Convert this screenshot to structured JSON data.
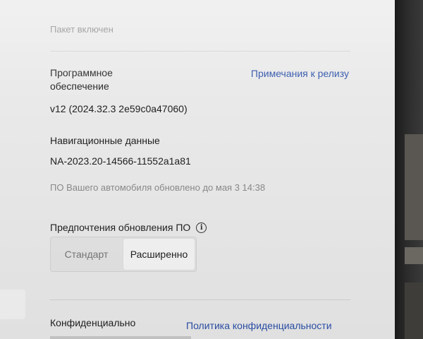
{
  "package": {
    "status": "Пакет включен"
  },
  "software": {
    "label": "Программное обеспечение",
    "release_notes_link": "Примечания к релизу",
    "version": "v12 (2024.32.3 2e59c0a47060)"
  },
  "navigation": {
    "label": "Навигационные данные",
    "version": "NA-2023.20-14566-11552a1a81"
  },
  "update_status": "ПО Вашего автомобиля обновлено до мая 3 14:38",
  "update_preferences": {
    "label": "Предпочтения обновления ПО",
    "info_icon": "info-icon",
    "options": [
      "Стандарт",
      "Расширенно"
    ],
    "selected": "Расширенно"
  },
  "privacy": {
    "label": "Конфиденциально",
    "policy_link": "Политика конфиденциальности"
  },
  "colors": {
    "background": "#e9e9e9",
    "link": "#2a4fa8",
    "text": "#1f1f1f",
    "muted": "#8a8a8a"
  }
}
